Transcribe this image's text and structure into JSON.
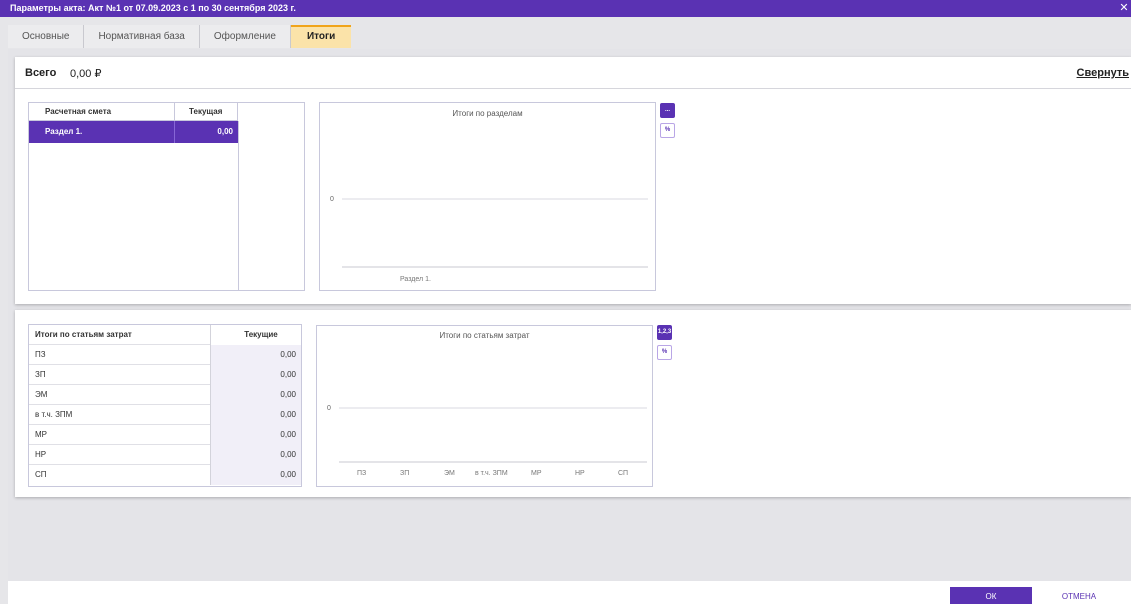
{
  "window": {
    "title": "Параметры акта: Акт №1 от 07.09.2023 с 1 по 30 сентября 2023 г.",
    "close_glyph": "✕"
  },
  "tabs": [
    {
      "label": "Основные"
    },
    {
      "label": "Нормативная база"
    },
    {
      "label": "Оформление"
    },
    {
      "label": "Итоги",
      "active": true
    }
  ],
  "summary": {
    "total_label": "Всего",
    "total_value": "0,00 ₽",
    "collapse_label": "Свернуть"
  },
  "estimate_table": {
    "headers": [
      "Расчетная смета",
      "Текущая"
    ],
    "rows": [
      {
        "name": "Раздел 1.",
        "value": "0,00"
      }
    ]
  },
  "sections_chart": {
    "buttons": [
      "...",
      "%"
    ],
    "chart_data": {
      "type": "bar",
      "title": "Итоги по разделам",
      "categories": [
        "Раздел 1."
      ],
      "values": [
        0
      ],
      "y_ticks": [
        "0"
      ]
    }
  },
  "cost_table": {
    "headers": [
      "Итоги по статьям затрат",
      "Текущие"
    ],
    "rows": [
      {
        "name": "ПЗ",
        "value": "0,00"
      },
      {
        "name": "ЗП",
        "value": "0,00"
      },
      {
        "name": "ЭМ",
        "value": "0,00"
      },
      {
        "name": "в т.ч. ЗПМ",
        "value": "0,00"
      },
      {
        "name": "МР",
        "value": "0,00"
      },
      {
        "name": "НР",
        "value": "0,00"
      },
      {
        "name": "СП",
        "value": "0,00"
      }
    ]
  },
  "cost_chart": {
    "buttons": [
      "1,2,3",
      "%"
    ],
    "chart_data": {
      "type": "bar",
      "title": "Итоги по статьям затрат",
      "categories": [
        "ПЗ",
        "ЗП",
        "ЭМ",
        "в т.ч. ЗПМ",
        "МР",
        "НР",
        "СП"
      ],
      "values": [
        0,
        0,
        0,
        0,
        0,
        0,
        0
      ],
      "y_ticks": [
        "0"
      ]
    }
  },
  "footer": {
    "ok_label": "ОК",
    "cancel_label": "ОТМЕНА"
  },
  "colors": {
    "accent": "#5a32b3",
    "active_tab": "#fbe3a9",
    "active_tab_border": "#f0a41b"
  }
}
